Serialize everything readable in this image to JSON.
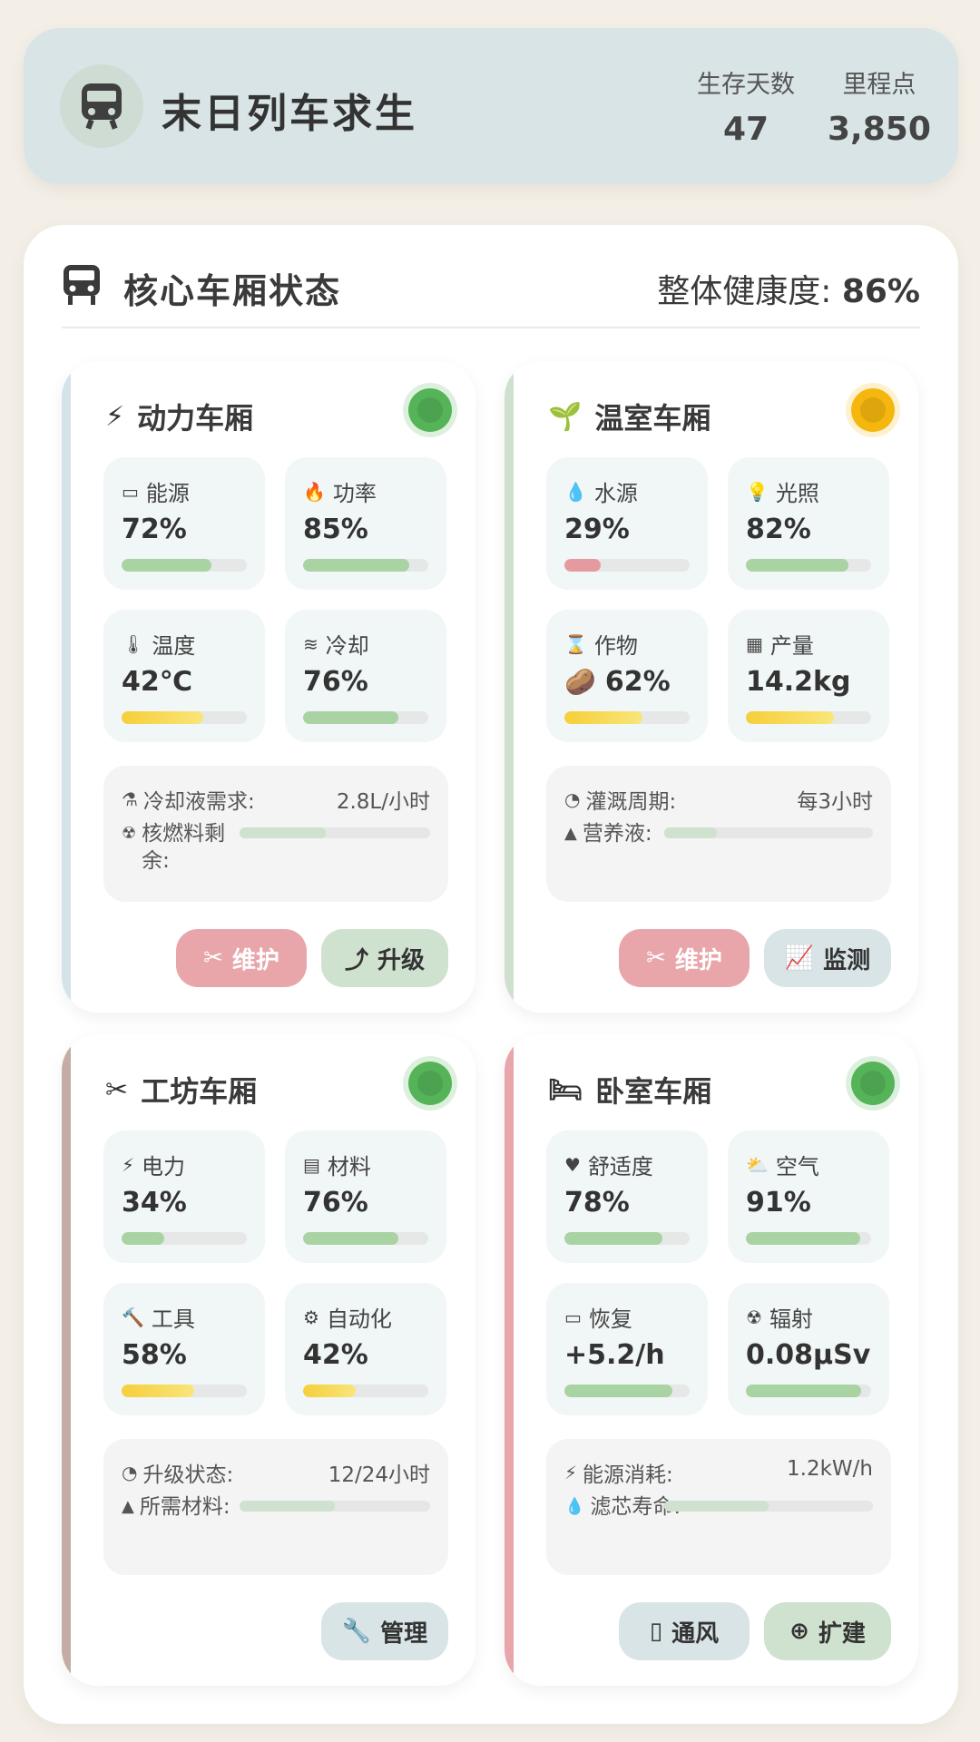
{
  "header": {
    "title": "末日列车求生",
    "stats": [
      {
        "label": "生存天数",
        "value": "47"
      },
      {
        "label": "里程点",
        "value": "3,850"
      }
    ]
  },
  "panel": {
    "title": "核心车厢状态",
    "health_label": "整体健康度:",
    "health_value": "86%"
  },
  "cars": [
    {
      "title": "动力车厢",
      "status_color": "#4caf50",
      "stripe_color": "#d4e2ea",
      "metrics": [
        {
          "label": "能源",
          "value": "72%",
          "level": 0.72,
          "bar": "green",
          "icon": "battery-icon"
        },
        {
          "label": "功率",
          "value": "85%",
          "level": 0.85,
          "bar": "green",
          "icon": "fire-icon"
        },
        {
          "label": "温度",
          "value": "42℃",
          "level": 0.65,
          "bar": "yellow",
          "icon": "thermometer-icon"
        },
        {
          "label": "冷却",
          "value": "76%",
          "level": 0.76,
          "bar": "green",
          "icon": "wind-icon"
        }
      ],
      "info": {
        "key1": "冷却液需求:",
        "val1": "2.8L/小时",
        "key2": "核燃料剩余:",
        "level2": 0.45
      },
      "buttons": [
        {
          "label": "维护",
          "style": "pink",
          "icon": "tools-icon"
        },
        {
          "label": "升级",
          "style": "green",
          "icon": "arrow-up-icon"
        }
      ]
    },
    {
      "title": "温室车厢",
      "status_color": "#f5b400",
      "stripe_color": "#cfe0cf",
      "metrics": [
        {
          "label": "水源",
          "value": "29%",
          "level": 0.29,
          "bar": "red",
          "icon": "water-drop-icon"
        },
        {
          "label": "光照",
          "value": "82%",
          "level": 0.82,
          "bar": "green",
          "icon": "bulb-icon"
        },
        {
          "label": "作物",
          "value": "62%",
          "level": 0.62,
          "bar": "yellow",
          "icon": "hourglass-icon",
          "emoji": "🥔"
        },
        {
          "label": "产量",
          "value": "14.2kg",
          "level": 0.7,
          "bar": "yellow",
          "icon": "box-icon"
        }
      ],
      "info": {
        "key1": "灌溉周期:",
        "val1": "每3小时",
        "key2": "营养液:",
        "level2": 0.25
      },
      "buttons": [
        {
          "label": "维护",
          "style": "pink",
          "icon": "tools-icon"
        },
        {
          "label": "监测",
          "style": "blue",
          "icon": "chart-line-icon"
        }
      ]
    },
    {
      "title": "工坊车厢",
      "status_color": "#4caf50",
      "stripe_color": "#c3ada6",
      "metrics": [
        {
          "label": "电力",
          "value": "34%",
          "level": 0.34,
          "bar": "green",
          "icon": "bolt-icon"
        },
        {
          "label": "材料",
          "value": "76%",
          "level": 0.76,
          "bar": "green",
          "icon": "boxes-icon"
        },
        {
          "label": "工具",
          "value": "58%",
          "level": 0.58,
          "bar": "yellow",
          "icon": "hammer-icon"
        },
        {
          "label": "自动化",
          "value": "42%",
          "level": 0.42,
          "bar": "yellow",
          "icon": "gears-icon"
        }
      ],
      "info": {
        "key1": "升级状态:",
        "val1": "12/24小时",
        "key2": "所需材料:",
        "level2": 0.5
      },
      "buttons": [
        {
          "label": "管理",
          "style": "blue",
          "icon": "wrench-icon"
        }
      ]
    },
    {
      "title": "卧室车厢",
      "status_color": "#4caf50",
      "stripe_color": "#e8a6ab",
      "metrics": [
        {
          "label": "舒适度",
          "value": "78%",
          "level": 0.78,
          "bar": "green",
          "icon": "heart-icon"
        },
        {
          "label": "空气",
          "value": "91%",
          "level": 0.91,
          "bar": "green",
          "icon": "cloud-sun-icon"
        },
        {
          "label": "恢复",
          "value": "+5.2/h",
          "level": 0.86,
          "bar": "green",
          "icon": "battery-icon"
        },
        {
          "label": "辐射",
          "value": "0.08μSv",
          "level": 0.92,
          "bar": "green",
          "icon": "radiation-icon"
        }
      ],
      "info": {
        "key1": "能源消耗:",
        "val1": "1.2kW/h",
        "key2": "滤芯寿命:",
        "level2": 0.5
      },
      "buttons": [
        {
          "label": "通风",
          "style": "blue",
          "icon": "spray-icon"
        },
        {
          "label": "扩建",
          "style": "green",
          "icon": "plus-circle-icon"
        }
      ]
    }
  ]
}
